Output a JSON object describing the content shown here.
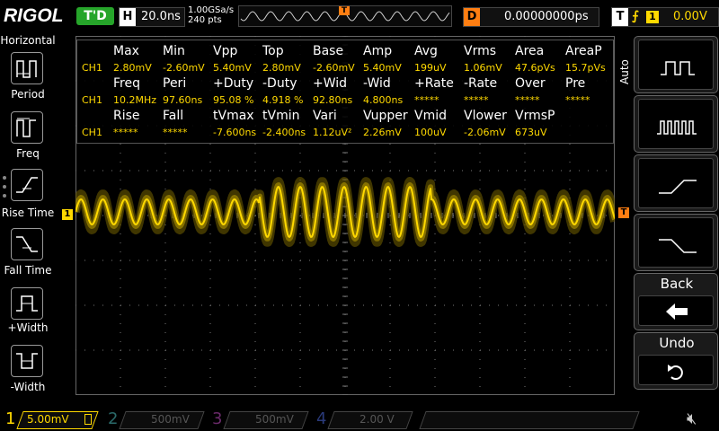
{
  "app": {
    "logo": "RIGOL",
    "run_status": "T'D"
  },
  "horizontal": {
    "letter": "H",
    "timebase": "20.0ns",
    "sample_rate": "1.00GSa/s",
    "memory_depth": "240 pts",
    "trigger_marker": "T"
  },
  "delay": {
    "letter": "D",
    "value": "0.00000000ps"
  },
  "trigger": {
    "letter": "T",
    "edge_icon": "rising-edge-icon",
    "source": "1",
    "level": "0.00V"
  },
  "left_menu": {
    "title": "Horizontal",
    "items": [
      {
        "label": "Period",
        "icon": "period-icon"
      },
      {
        "label": "Freq",
        "icon": "frequency-icon"
      },
      {
        "label": "Rise Time",
        "icon": "rise-time-icon"
      },
      {
        "label": "Fall Time",
        "icon": "fall-time-icon"
      },
      {
        "label": "+Width",
        "icon": "positive-width-icon"
      },
      {
        "label": "-Width",
        "icon": "negative-width-icon"
      }
    ]
  },
  "measurements": {
    "rows": [
      {
        "type": "header",
        "cells": [
          "Max",
          "Min",
          "Vpp",
          "Top",
          "Base",
          "Amp",
          "Avg",
          "Vrms",
          "Area",
          "AreaP"
        ]
      },
      {
        "type": "value",
        "channel": "CH1",
        "cells": [
          "2.80mV",
          "-2.60mV",
          "5.40mV",
          "2.80mV",
          "-2.60mV",
          "5.40mV",
          "199uV",
          "1.06mV",
          "47.6pVs",
          "15.7pVs"
        ]
      },
      {
        "type": "header",
        "cells": [
          "Freq",
          "Peri",
          "+Duty",
          "-Duty",
          "+Wid",
          "-Wid",
          "+Rate",
          "-Rate",
          "Over",
          "Pre"
        ]
      },
      {
        "type": "value",
        "channel": "CH1",
        "cells": [
          "10.2MHz",
          "97.60ns",
          "95.08 %",
          "4.918 %",
          "92.80ns",
          "4.800ns",
          "*****",
          "*****",
          "*****",
          "*****"
        ]
      },
      {
        "type": "header",
        "cells": [
          "Rise",
          "Fall",
          "tVmax",
          "tVmin",
          "Vari",
          "Vupper",
          "Vmid",
          "Vlower",
          "VrmsP",
          ""
        ]
      },
      {
        "type": "value",
        "channel": "CH1",
        "cells": [
          "*****",
          "*****",
          "-7.600ns",
          "-2.400ns",
          "1.12uV²",
          "2.26mV",
          "100uV",
          "-2.06mV",
          "673uV",
          ""
        ]
      }
    ]
  },
  "markers": {
    "ch1_ground": "1",
    "trigger_level": "T"
  },
  "right_menu": {
    "mode_tab": "Auto",
    "buttons": [
      {
        "icon": "pulse-slow-icon"
      },
      {
        "icon": "pulse-fast-icon"
      },
      {
        "icon": "rising-ramp-icon"
      },
      {
        "icon": "falling-ramp-icon"
      }
    ],
    "back_label": "Back",
    "back_icon": "arrow-left-icon",
    "undo_label": "Undo",
    "undo_icon": "undo-icon"
  },
  "channels": [
    {
      "number": "1",
      "scale": "5.00mV",
      "color": "#ffd900",
      "active": true
    },
    {
      "number": "2",
      "scale": "500mV",
      "color": "#00c0c0",
      "active": false
    },
    {
      "number": "3",
      "scale": "500mV",
      "color": "#d020d0",
      "active": false
    },
    {
      "number": "4",
      "scale": "2.00 V",
      "color": "#3a6cff",
      "active": false
    }
  ],
  "speaker_icon": "speaker-muted-icon"
}
